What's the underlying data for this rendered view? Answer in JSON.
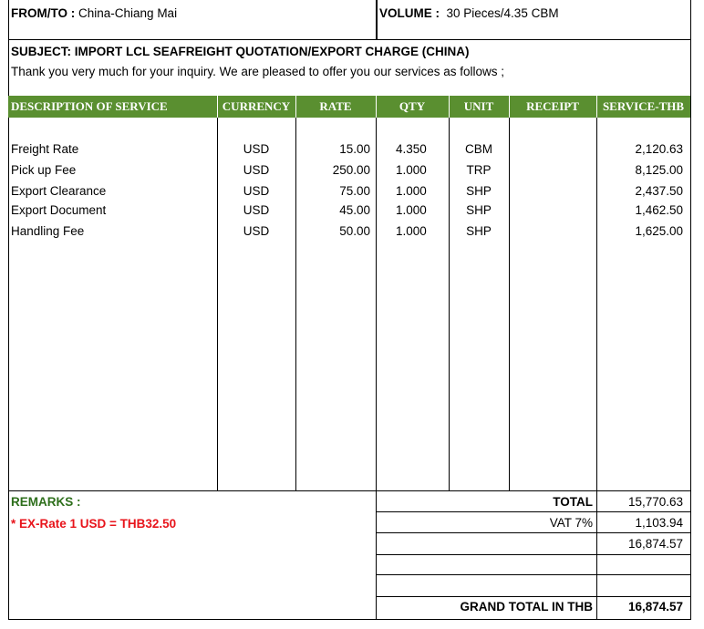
{
  "header": {
    "from_to_label": "FROM/TO :",
    "from_to_value": "China-Chiang Mai",
    "volume_label": "VOLUME :",
    "volume_value": "30 Pieces/4.35 CBM"
  },
  "subject": {
    "title": "SUBJECT: IMPORT LCL SEAFREIGHT QUOTATION/EXPORT CHARGE (CHINA)",
    "intro": "Thank you very much for your inquiry. We are pleased to offer you our services as follows ;"
  },
  "table": {
    "columns": [
      "DESCRIPTION OF SERVICE",
      "CURRENCY",
      "RATE",
      "QTY",
      "UNIT",
      "RECEIPT",
      "SERVICE-THB"
    ],
    "rows": [
      {
        "description": "Freight Rate",
        "currency": "USD",
        "rate": "15.00",
        "qty": "4.350",
        "unit": "CBM",
        "receipt": "",
        "service_thb": "2,120.63"
      },
      {
        "description": "Pick up Fee",
        "currency": "USD",
        "rate": "250.00",
        "qty": "1.000",
        "unit": "TRP",
        "receipt": "",
        "service_thb": "8,125.00"
      },
      {
        "description": "Export Clearance",
        "currency": "USD",
        "rate": "75.00",
        "qty": "1.000",
        "unit": "SHP",
        "receipt": "",
        "service_thb": "2,437.50"
      },
      {
        "description": "Export Document",
        "currency": "USD",
        "rate": "45.00",
        "qty": "1.000",
        "unit": "SHP",
        "receipt": "",
        "service_thb": "1,462.50"
      },
      {
        "description": "Handling Fee",
        "currency": "USD",
        "rate": "50.00",
        "qty": "1.000",
        "unit": "SHP",
        "receipt": "",
        "service_thb": "1,625.00"
      }
    ]
  },
  "remarks": {
    "label": "REMARKS :",
    "note": "* EX-Rate 1 USD = THB32.50"
  },
  "totals": {
    "total_label": "TOTAL",
    "total_value": "15,770.63",
    "vat_label": "VAT 7%",
    "vat_value": "1,103.94",
    "subtotal_value": "16,874.57",
    "grand_label": "GRAND TOTAL IN THB",
    "grand_value": "16,874.57"
  },
  "colors": {
    "header_bg": "#5a8f30",
    "remarks_label": "#2e6f1c",
    "remarks_note": "#e8141b"
  }
}
